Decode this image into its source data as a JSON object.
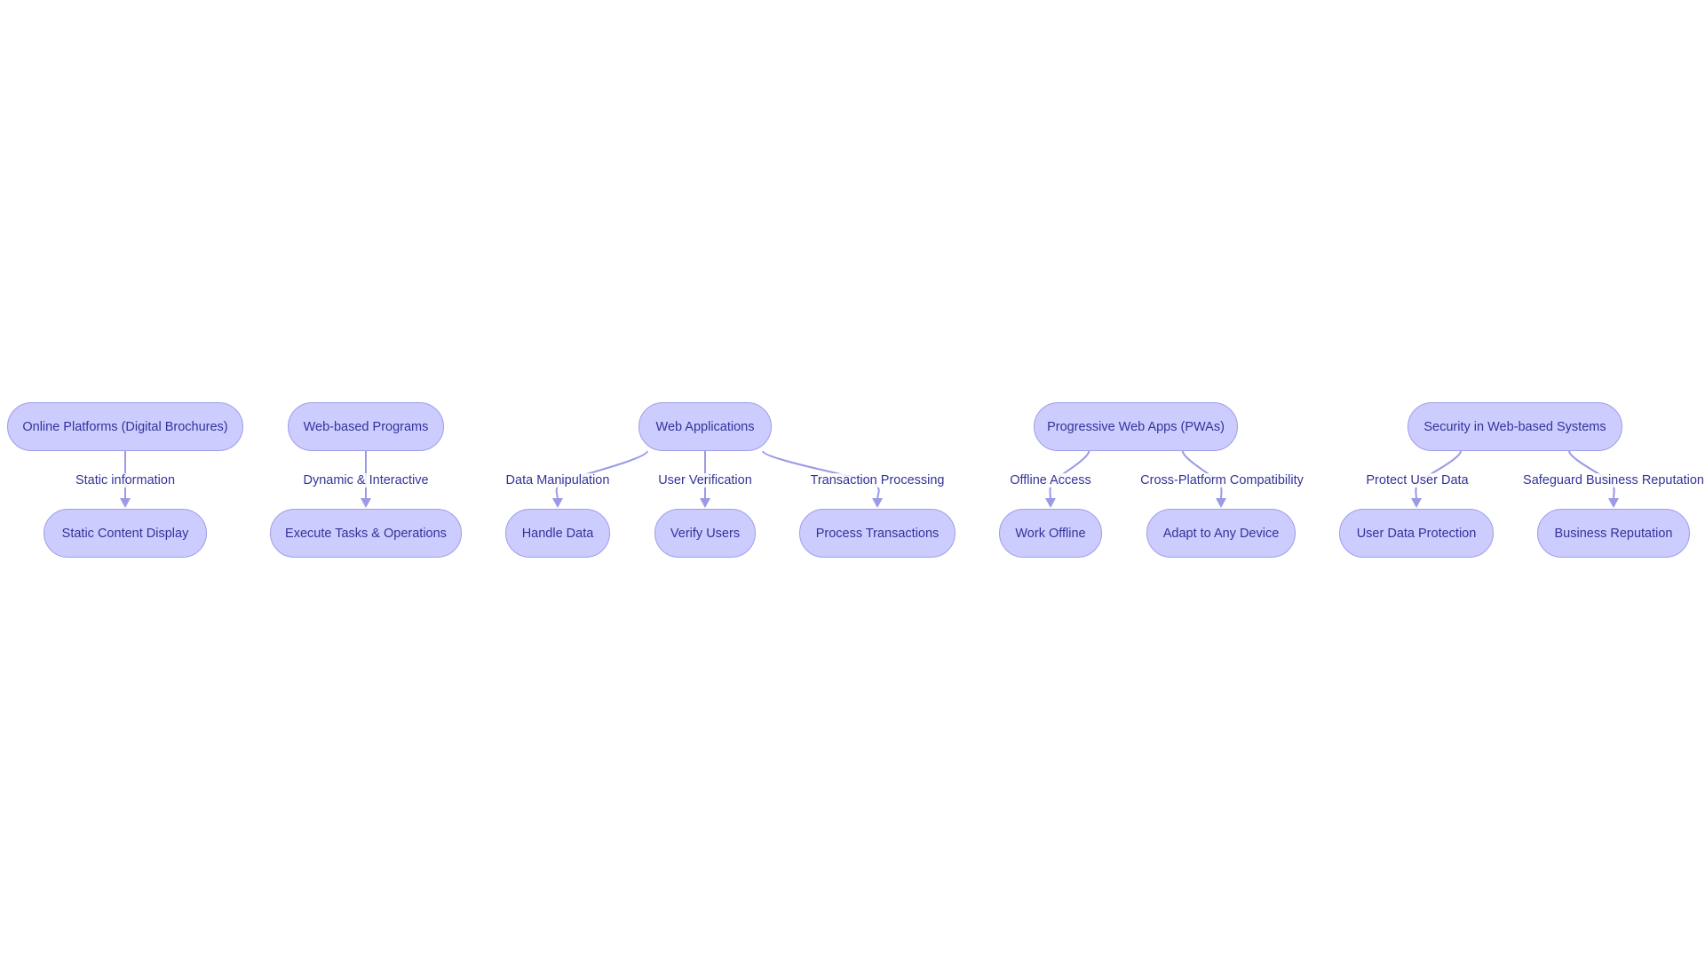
{
  "diagram": {
    "type": "flowchart",
    "colors": {
      "node_fill": "#ccccff",
      "node_border": "#9e9ee8",
      "text": "#333399",
      "edge": "#9a9ae6"
    },
    "nodes": [
      {
        "id": "online_platforms",
        "label": "Online Platforms (Digital Brochures)"
      },
      {
        "id": "static_content",
        "label": "Static Content Display"
      },
      {
        "id": "web_programs",
        "label": "Web-based Programs"
      },
      {
        "id": "execute_tasks",
        "label": "Execute Tasks & Operations"
      },
      {
        "id": "web_apps",
        "label": "Web Applications"
      },
      {
        "id": "handle_data",
        "label": "Handle Data"
      },
      {
        "id": "verify_users",
        "label": "Verify Users"
      },
      {
        "id": "process_transactions",
        "label": "Process Transactions"
      },
      {
        "id": "pwas",
        "label": "Progressive Web Apps (PWAs)"
      },
      {
        "id": "work_offline",
        "label": "Work Offline"
      },
      {
        "id": "adapt_device",
        "label": "Adapt to Any Device"
      },
      {
        "id": "security",
        "label": "Security in Web-based Systems"
      },
      {
        "id": "user_data_protection",
        "label": "User Data Protection"
      },
      {
        "id": "business_reputation",
        "label": "Business Reputation"
      }
    ],
    "edges": [
      {
        "from": "online_platforms",
        "to": "static_content",
        "label": "Static information"
      },
      {
        "from": "web_programs",
        "to": "execute_tasks",
        "label": "Dynamic & Interactive"
      },
      {
        "from": "web_apps",
        "to": "handle_data",
        "label": "Data Manipulation"
      },
      {
        "from": "web_apps",
        "to": "verify_users",
        "label": "User Verification"
      },
      {
        "from": "web_apps",
        "to": "process_transactions",
        "label": "Transaction Processing"
      },
      {
        "from": "pwas",
        "to": "work_offline",
        "label": "Offline Access"
      },
      {
        "from": "pwas",
        "to": "adapt_device",
        "label": "Cross-Platform Compatibility"
      },
      {
        "from": "security",
        "to": "user_data_protection",
        "label": "Protect User Data"
      },
      {
        "from": "security",
        "to": "business_reputation",
        "label": "Safeguard Business Reputation"
      }
    ]
  }
}
